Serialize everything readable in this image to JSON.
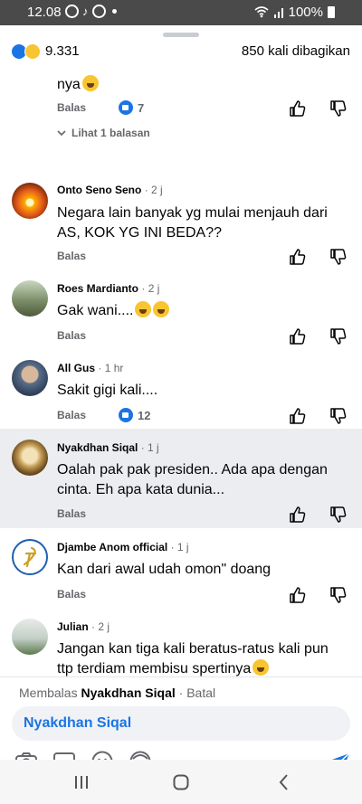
{
  "status": {
    "time": "12.08",
    "battery": "100%"
  },
  "sheet": {
    "reaction_count": "9.331",
    "share_text": "850 kali dibagikan"
  },
  "comments": [
    {
      "text_tail": "nya",
      "reply_label": "Balas",
      "likes": "7",
      "view_replies": "Lihat 1 balasan"
    },
    {
      "name": "Onto Seno Seno",
      "time": "· 2 j",
      "text": "Negara lain banyak yg mulai menjauh dari AS, KOK YG INI BEDA??",
      "reply_label": "Balas"
    },
    {
      "name": "Roes Mardianto",
      "time": "· 2 j",
      "text": "Gak wani....",
      "reply_label": "Balas"
    },
    {
      "name": "All Gus",
      "time": "· 1 hr",
      "text": "Sakit gigi kali....",
      "reply_label": "Balas",
      "likes": "12"
    },
    {
      "name": "Nyakdhan Siqal",
      "time": "· 1 j",
      "text": "Oalah pak pak presiden.. Ada apa dengan cinta. Eh apa kata dunia...",
      "reply_label": "Balas"
    },
    {
      "name": "Djambe Anom official",
      "time": "· 1 j",
      "text": "Kan dari awal udah omon\" doang",
      "reply_label": "Balas"
    },
    {
      "name": "Julian",
      "time": "· 2 j",
      "text": "Jangan kan tiga kali beratus-ratus kali pun ttp terdiam membisu spertinya"
    }
  ],
  "composer": {
    "replying_prefix": "Membalas",
    "replying_to": "Nyakdhan Siqal",
    "cancel": "· Batal",
    "input_value": "Nyakdhan Siqal",
    "tools": [
      "camera-icon",
      "gif-icon",
      "emoji-icon",
      "avatar-sticker-icon",
      "send-icon"
    ]
  },
  "colors": {
    "accent": "#1b74e4",
    "highlight": "#ebedf0",
    "secondary_text": "#65676b"
  }
}
